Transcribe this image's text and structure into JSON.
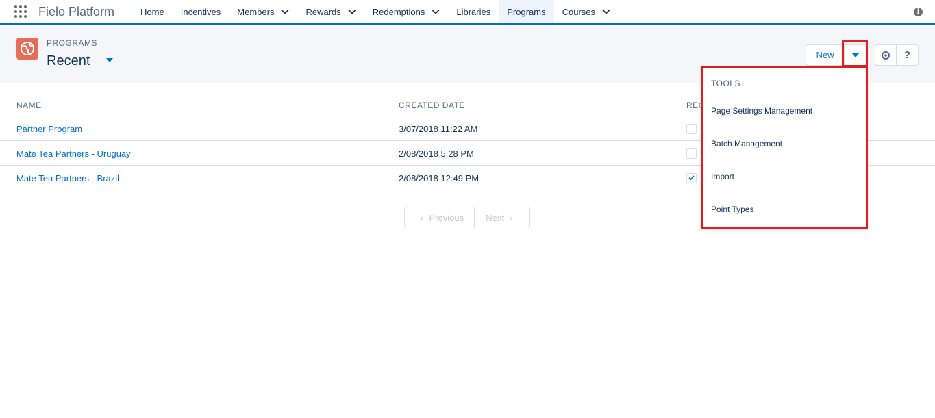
{
  "app": {
    "name": "Fielo Platform"
  },
  "nav": {
    "tabs": [
      {
        "label": "Home",
        "has_menu": false
      },
      {
        "label": "Incentives",
        "has_menu": false
      },
      {
        "label": "Members",
        "has_menu": true
      },
      {
        "label": "Rewards",
        "has_menu": true
      },
      {
        "label": "Redemptions",
        "has_menu": true
      },
      {
        "label": "Libraries",
        "has_menu": false
      },
      {
        "label": "Programs",
        "has_menu": false,
        "active": true
      },
      {
        "label": "Courses",
        "has_menu": true
      }
    ]
  },
  "header": {
    "object_label": "PROGRAMS",
    "list_view": "Recent",
    "new_button": "New",
    "help_button": "?"
  },
  "table": {
    "columns": [
      "NAME",
      "CREATED DATE",
      "REC"
    ],
    "rows": [
      {
        "name": "Partner Program",
        "created": "3/07/2018 11:22 AM",
        "checked": false
      },
      {
        "name": "Mate Tea Partners - Uruguay",
        "created": "2/08/2018 5:28 PM",
        "checked": false
      },
      {
        "name": "Mate Tea Partners - Brazil",
        "created": "2/08/2018 12:49 PM",
        "checked": true
      }
    ]
  },
  "pager": {
    "previous": "Previous",
    "next": "Next"
  },
  "dropdown": {
    "heading": "TOOLS",
    "items": [
      "Page Settings Management",
      "Batch Management",
      "Import",
      "Point Types"
    ]
  },
  "colors": {
    "accent": "#0070d2",
    "highlight": "#e02020",
    "object_icon": "#e46e5a"
  }
}
